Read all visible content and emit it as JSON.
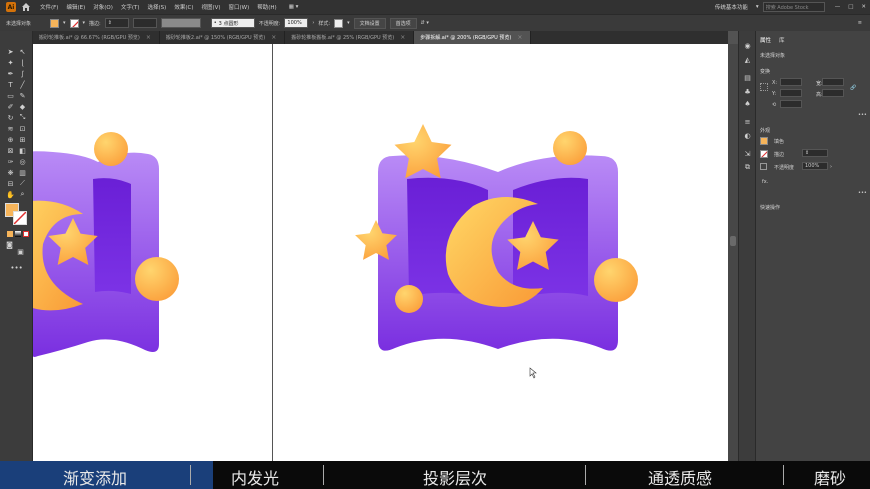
{
  "menubar": {
    "logo": "Ai",
    "items": [
      "文件(F)",
      "编辑(E)",
      "对象(O)",
      "文字(T)",
      "选择(S)",
      "效果(C)",
      "视图(V)",
      "窗口(W)",
      "帮助(H)"
    ],
    "workspace": "传统基本功能",
    "search_placeholder": "搜索 Adobe Stock"
  },
  "controlbar": {
    "selection_label": "未选择对象",
    "stroke_label": "描边:",
    "brush_label": "3 点圆形",
    "opacity_label": "不透明度:",
    "opacity_value": "100%",
    "style_label": "样式:",
    "doc_setup": "文档设置",
    "prefs": "首选项"
  },
  "tabs": [
    {
      "label": "搬砂轮推板.ai* @ 66.67% (RGB/GPU 预览)",
      "active": false
    },
    {
      "label": "搬砂轮推板2.ai* @ 150% (RGB/GPU 预览)",
      "active": false
    },
    {
      "label": "搬砂轮推板搬板.ai* @ 25% (RGB/GPU 预览)",
      "active": false
    },
    {
      "label": "步骤拆解.ai* @ 200% (RGB/GPU 预览)",
      "active": true
    }
  ],
  "panel": {
    "tab_properties": "属性",
    "tab_libraries": "库",
    "no_selection": "未选择对象",
    "transform": "变换",
    "x_label": "X:",
    "y_label": "Y:",
    "w_label": "宽:",
    "h_label": "高:",
    "appearance": "外观",
    "fill_label": "填色",
    "stroke_label": "描边",
    "opacity_label": "不透明度",
    "opacity_value": "100%",
    "fx": "fx.",
    "quick_actions": "快速操作"
  },
  "bottom_bar": [
    "渐变添加",
    "内发光",
    "投影层次",
    "通透质感",
    "磨砂"
  ],
  "colors": {
    "fill_swatch": "#f6b45a",
    "book_purple_top": "#b88af5",
    "book_purple_bottom": "#7b2fe0",
    "inner_page": "#6a1fd6",
    "star_gold": "#fdb44b",
    "moon_gold": "#fcc24a",
    "bottom_bar_blue": "#1a3f7a"
  }
}
